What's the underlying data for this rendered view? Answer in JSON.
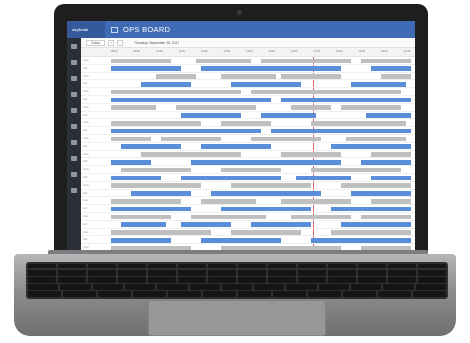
{
  "app": {
    "logo_text": "skyfreak",
    "title": "OPS BOARD"
  },
  "toolbar": {
    "today_label": "Today",
    "prev_label": "‹",
    "next_label": "›",
    "date_label": "Thursday, September 28, 2017"
  },
  "sidebar_icons": [
    "home-icon",
    "grid-icon",
    "list-icon",
    "calendar-icon",
    "users-icon",
    "plane-icon",
    "settings-icon",
    "chart-icon",
    "bell-icon",
    "help-icon"
  ],
  "time_ticks": [
    "08:00",
    "09:00",
    "10:00",
    "11:00",
    "12:00",
    "13:00",
    "14:00",
    "15:00",
    "16:00",
    "17:00",
    "18:00",
    "19:00",
    "20:00",
    "21:00"
  ],
  "row_labels": {
    "crew": "Crew",
    "aircraft": "Acft"
  },
  "colors": {
    "brand": "#3f6ab4",
    "bar_gray": "#bfbfbf",
    "bar_blue": "#5b8ed8",
    "now": "#d8303a"
  }
}
